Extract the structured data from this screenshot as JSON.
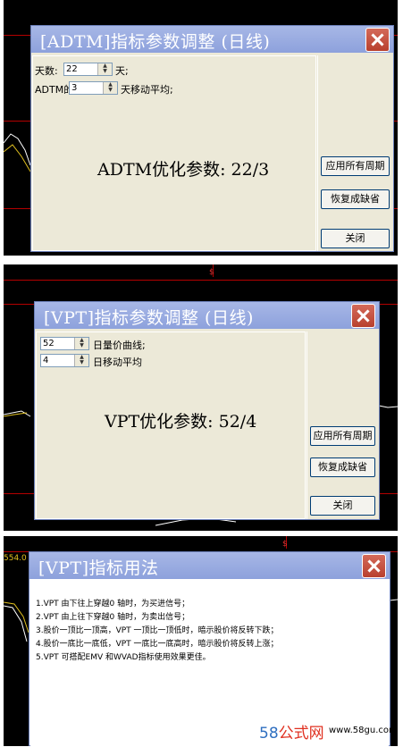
{
  "dialog1": {
    "title": "[ADTM]指标参数调整 (日线)",
    "param1": {
      "label": "天数:",
      "value": "22",
      "unit": "天;"
    },
    "param2": {
      "label": "ADTM的",
      "value": "3",
      "unit": "天移动平均;"
    },
    "optimized": "ADTM优化参数: 22/3",
    "buttons": {
      "apply_all": "应用所有周期",
      "restore_default": "恢复成缺省",
      "close": "关闭"
    }
  },
  "dialog2": {
    "title": "[VPT]指标参数调整 (日线)",
    "param1": {
      "value": "52",
      "label": "日量价曲线;"
    },
    "param2": {
      "value": "4",
      "label": "日移动平均"
    },
    "optimized": "VPT优化参数: 52/4",
    "buttons": {
      "apply_all": "应用所有周期",
      "restore_default": "恢复成缺省",
      "close": "关闭"
    }
  },
  "dialog3": {
    "title": "[VPT]指标用法",
    "lines": [
      "1.VPT 由下往上穿越0 轴时，为买进信号；",
      "2.VPT 由上往下穿越0 轴时，为卖出信号；",
      "3.股价一顶比一顶高，VPT 一顶比一顶低时，暗示股价将反转下跌；",
      "4.股价一底比一底低，VPT 一底比一底高时，暗示股价将反转上涨；",
      "5.VPT 可搭配EMV 和WVAD指标使用效果更佳。"
    ]
  },
  "background": {
    "axis_label": "554.0",
    "marker": "$"
  },
  "watermark": {
    "brand_58": "58",
    "brand_rest": "公式网",
    "url": "www.58gu.com"
  }
}
